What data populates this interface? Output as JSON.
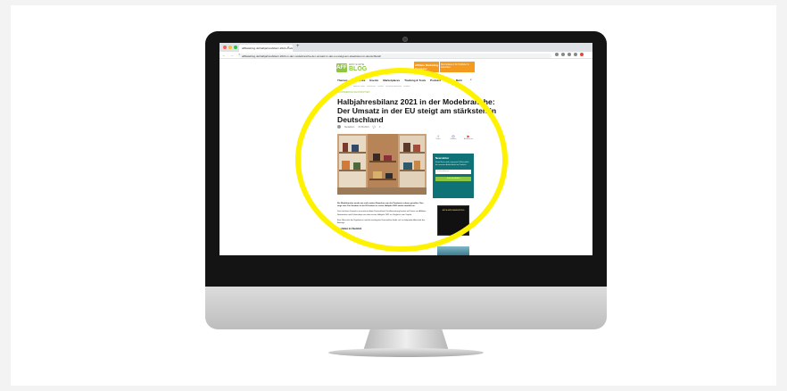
{
  "browser": {
    "tab_title": "affiliateblog.de/halbjahresbilanz-2021-mode",
    "tab_close": "×",
    "tab_new": "+",
    "nav_icons": "← → ↻",
    "url": "affiliateblog.de/halbjahresbilanz-2021-in-der-modebranche-der-umsatz-in-der-eu-steigt-am-staerksten-in-deutschland/"
  },
  "site": {
    "logo_mark": "AFF",
    "logo_top": "AFFILIATE",
    "logo_bottom": "BLOG",
    "banner_left": "Affiliate Marketing Kongress",
    "banner_right": "Die Konferenz für Publisher & Advertiser",
    "nav": [
      "Themen",
      "Netzwerke",
      "Events",
      "Marketplaces",
      "Tracking & Tools",
      "Podcast",
      "Jobs",
      "Mehr"
    ],
    "nav_search_icon": "⌕",
    "subnav": "Affiliate News · Interviews · Guides · Partnerprogramme · Studien"
  },
  "article": {
    "breadcrumb": "E-COMMERCE    NACHRICHTEN",
    "title": "Halbjahresbilanz 2021 in der Modebranche: Der Umsatz in der EU steigt am stärksten in Deutschland",
    "author": "Redaktion",
    "date": "26.08.2021",
    "comments": "0",
    "paragraphs": [
      "Die Modebranche wurde wie viele andere Branchen von der Pandemie schwer getroffen. Nun zeigt sich: Die Umsätze in der EU ziehen im ersten Halbjahr 2021 wieder deutlich an.",
      "Den höchsten Zuwachs verzeichnet dabei Deutschland. Die Auswertung basiert auf Daten von Affiliate-Netzwerken und Onlineshops aus dem ersten Halbjahr 2021 im Vergleich zum Vorjahr.",
      "Eine Übersicht der Ergebnisse und der wichtigsten Kennzahlen findet sich im folgenden Abschnitt des Beitrags."
    ],
    "more_heading": "Die Zahlen im Überblick"
  },
  "sidebar": {
    "share": [
      {
        "icon": "f",
        "label": "Teilen",
        "color": "#3b5998"
      },
      {
        "icon": "◎",
        "label": "Senden",
        "color": "#3b5998"
      },
      {
        "icon": "▶",
        "label": "Abonnieren",
        "color": "#d9392b"
      }
    ],
    "newsletter_title": "Newsletter",
    "newsletter_text": "Keine News mehr verpassen! Wöchentlich die neuesten Artikel direkt ins Postfach.",
    "newsletter_placeholder": "E-Mail-Adresse",
    "newsletter_button": "Jetzt anmelden",
    "book_title": "AFFILIATE MARKETING"
  },
  "colors": {
    "brand_green": "#8dc63f",
    "banner_orange": "#f39a1f",
    "newsletter_teal": "#0f7277",
    "highlight_yellow": "#fff200"
  }
}
